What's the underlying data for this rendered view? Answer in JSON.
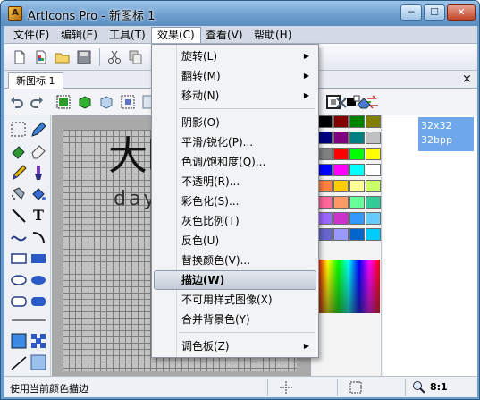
{
  "app": {
    "title": "ArtIcons Pro - 新图标 1",
    "icon_letter": "A"
  },
  "window_buttons": {
    "minimize": "─",
    "maximize": "☐",
    "close": "✕"
  },
  "menubar": {
    "items": [
      "文件(F)",
      "编辑(E)",
      "工具(T)",
      "效果(C)",
      "查看(V)",
      "帮助(H)"
    ],
    "active_index": 3
  },
  "document_tab": {
    "label": "新图标 1",
    "close": "×"
  },
  "effects_menu": {
    "items": [
      {
        "label": "旋转(L)",
        "submenu": true
      },
      {
        "label": "翻转(M)",
        "submenu": true
      },
      {
        "label": "移动(N)",
        "submenu": true
      },
      {
        "label": "阴影(O)"
      },
      {
        "label": "平滑/锐化(P)..."
      },
      {
        "label": "色调/饱和度(Q)..."
      },
      {
        "label": "不透明(R)..."
      },
      {
        "label": "彩色化(S)..."
      },
      {
        "label": "灰色比例(T)"
      },
      {
        "label": "反色(U)"
      },
      {
        "label": "替换颜色(V)..."
      },
      {
        "label": "描边(W)",
        "highlighted": true
      },
      {
        "label": "不可用样式图像(X)"
      },
      {
        "label": "合并背景色(Y)"
      },
      {
        "label": "调色板(Z)",
        "submenu": true
      }
    ],
    "submenu_arrow": "▶"
  },
  "format_panel": {
    "size": "32x32",
    "depth": "32bpp"
  },
  "palette": {
    "colors": [
      "#000000",
      "#800000",
      "#008000",
      "#808000",
      "#000080",
      "#800080",
      "#008080",
      "#c0c0c0",
      "#808080",
      "#ff0000",
      "#00ff00",
      "#ffff00",
      "#0000ff",
      "#ff00ff",
      "#00ffff",
      "#ffffff",
      "#ff8040",
      "#ffcc00",
      "#ffff99",
      "#ccff66",
      "#ff6699",
      "#ff9966",
      "#66ff99",
      "#33cc99",
      "#9966ff",
      "#cc33cc",
      "#3399ff",
      "#66ccff",
      "#6666cc",
      "#9999ff",
      "#0066cc",
      "#00ccff"
    ]
  },
  "statusbar": {
    "message": "使用当前颜色描边",
    "zoom": "8:1"
  },
  "watermark": {
    "cn": "大眼仔旭",
    "en": "dayanzai.me"
  }
}
